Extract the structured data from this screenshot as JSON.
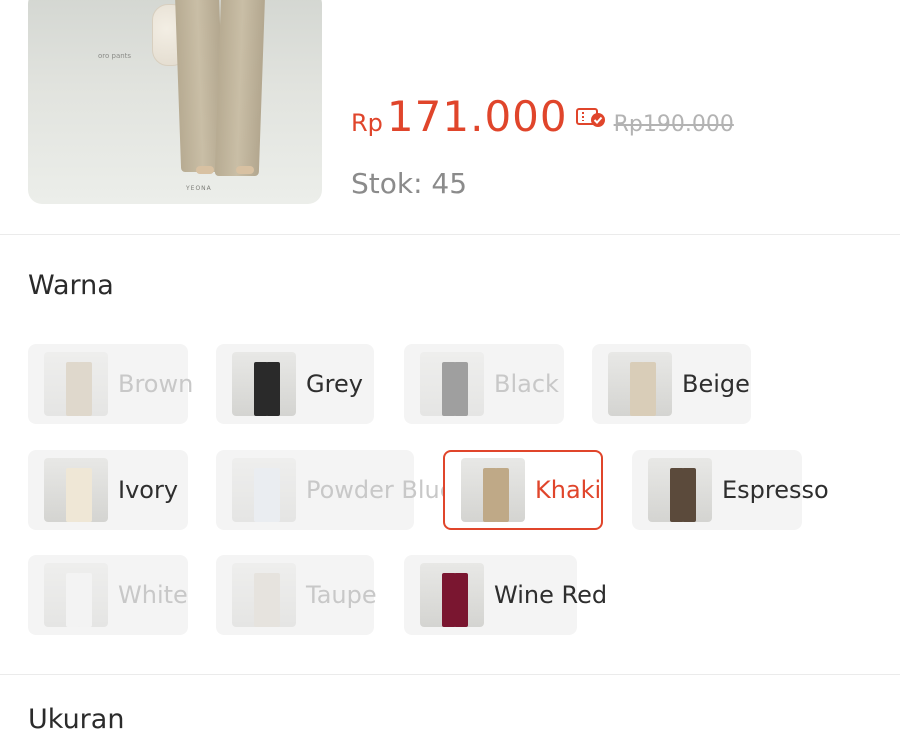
{
  "product": {
    "image_caption": "oro pants",
    "image_brand": "YEONA",
    "price_currency": "Rp",
    "price_value": "171.000",
    "old_price": "Rp190.000",
    "stock_label": "Stok: 45"
  },
  "colors": {
    "accent": "#e0452b",
    "chip_bg": "#f4f4f4",
    "disabled_text": "#c8c8c8"
  },
  "variants": {
    "title": "Warna",
    "options": [
      {
        "label": "Brown",
        "available": false,
        "selected": false,
        "swatch": "#c7b79d"
      },
      {
        "label": "Grey",
        "available": true,
        "selected": false,
        "swatch": "#2a2a2a"
      },
      {
        "label": "Black",
        "available": false,
        "selected": false,
        "swatch": "#3a3a3a"
      },
      {
        "label": "Beige",
        "available": true,
        "selected": false,
        "swatch": "#d9cdb8"
      },
      {
        "label": "Ivory",
        "available": true,
        "selected": false,
        "swatch": "#efe7d6"
      },
      {
        "label": "Powder Blue",
        "available": false,
        "selected": false,
        "swatch": "#dfe6ee"
      },
      {
        "label": "Khaki",
        "available": true,
        "selected": true,
        "swatch": "#bfa987"
      },
      {
        "label": "Espresso",
        "available": true,
        "selected": false,
        "swatch": "#5b4a3b"
      },
      {
        "label": "White",
        "available": false,
        "selected": false,
        "swatch": "#f2f2f2"
      },
      {
        "label": "Taupe",
        "available": false,
        "selected": false,
        "swatch": "#d6cfc4"
      },
      {
        "label": "Wine Red",
        "available": true,
        "selected": false,
        "swatch": "#7a1630"
      }
    ]
  },
  "next_section_title": "Ukuran"
}
